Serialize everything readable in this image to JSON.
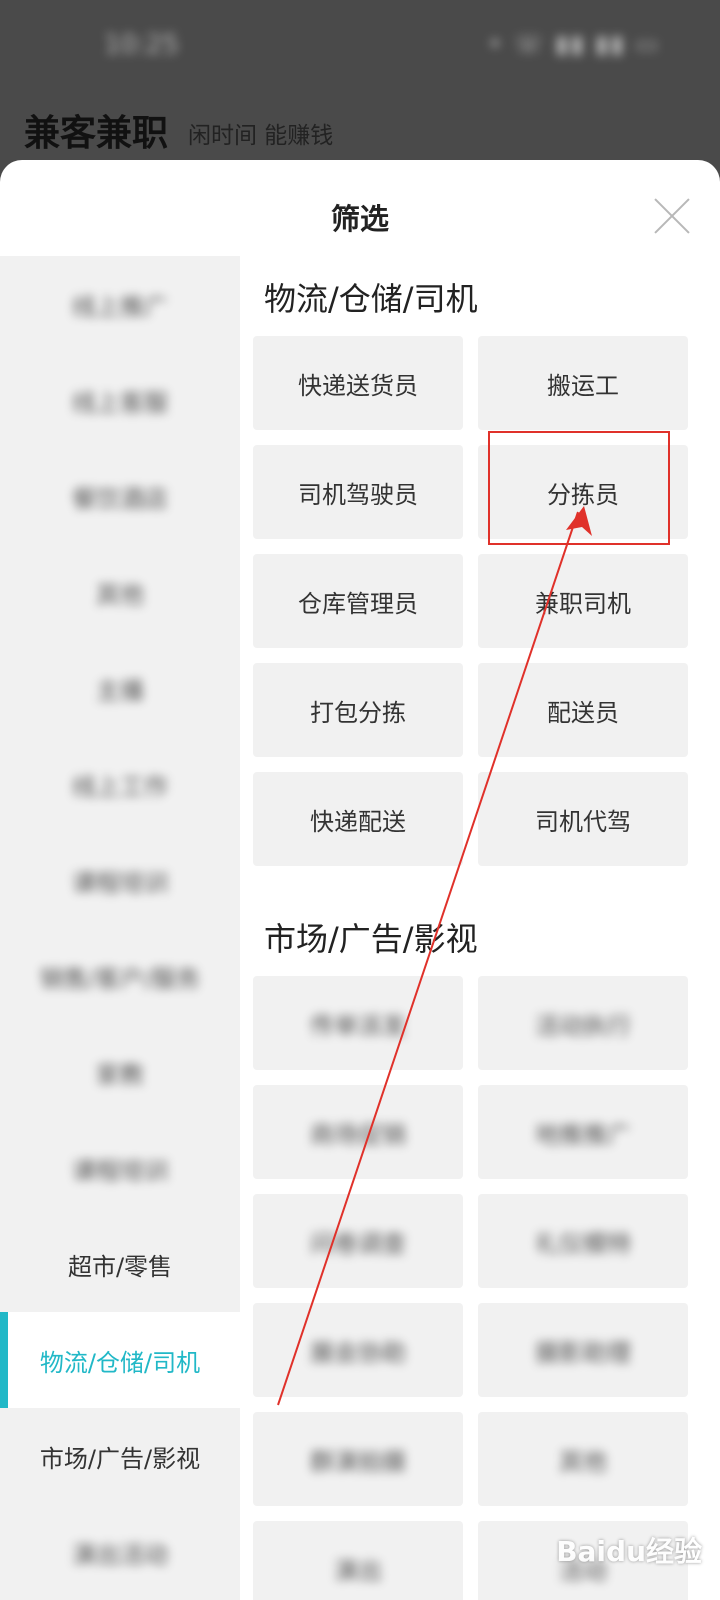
{
  "status": {
    "time": "10:25",
    "icons": "• ☏ ▮▮ ▮▮ ▭"
  },
  "app": {
    "title": "兼客兼职",
    "slogan": "闲时间 能赚钱"
  },
  "sheet": {
    "title": "筛选"
  },
  "sidebar": {
    "items": [
      {
        "label": "线上推广",
        "blurred": true
      },
      {
        "label": "线上客服",
        "blurred": true
      },
      {
        "label": "餐饮酒店",
        "blurred": true
      },
      {
        "label": "其他",
        "blurred": true
      },
      {
        "label": "主播",
        "blurred": true
      },
      {
        "label": "线上工作",
        "blurred": true
      },
      {
        "label": "课程培训",
        "blurred": true
      },
      {
        "label": "销售/客户/服务",
        "blurred": true
      },
      {
        "label": "家教",
        "blurred": true
      },
      {
        "label": "课程培训",
        "blurred": true
      },
      {
        "label": "超市/零售",
        "blurred": false
      },
      {
        "label": "物流/仓储/司机",
        "blurred": false,
        "active": true
      },
      {
        "label": "市场/广告/影视",
        "blurred": false
      },
      {
        "label": "演出活动",
        "blurred": true
      }
    ]
  },
  "sections": [
    {
      "title": "物流/仓储/司机",
      "tags": [
        "快递送货员",
        "搬运工",
        "司机驾驶员",
        "分拣员",
        "仓库管理员",
        "兼职司机",
        "打包分拣",
        "配送员",
        "快递配送",
        "司机代驾"
      ]
    },
    {
      "title": "市场/广告/影视",
      "tags": [
        "传单派发",
        "活动执行",
        "商场促销",
        "地推推广",
        "问卷调查",
        "礼仪模特",
        "展会协助",
        "摄影助理",
        "群演拍摄",
        "其他",
        "演出",
        "活动"
      ]
    }
  ],
  "annotation": {
    "highlight_target": "分拣员",
    "color": "#e0312a"
  },
  "watermark": "Baidu经验",
  "colors": {
    "accent": "#21b8c7",
    "tag_bg": "#f1f1f1"
  }
}
